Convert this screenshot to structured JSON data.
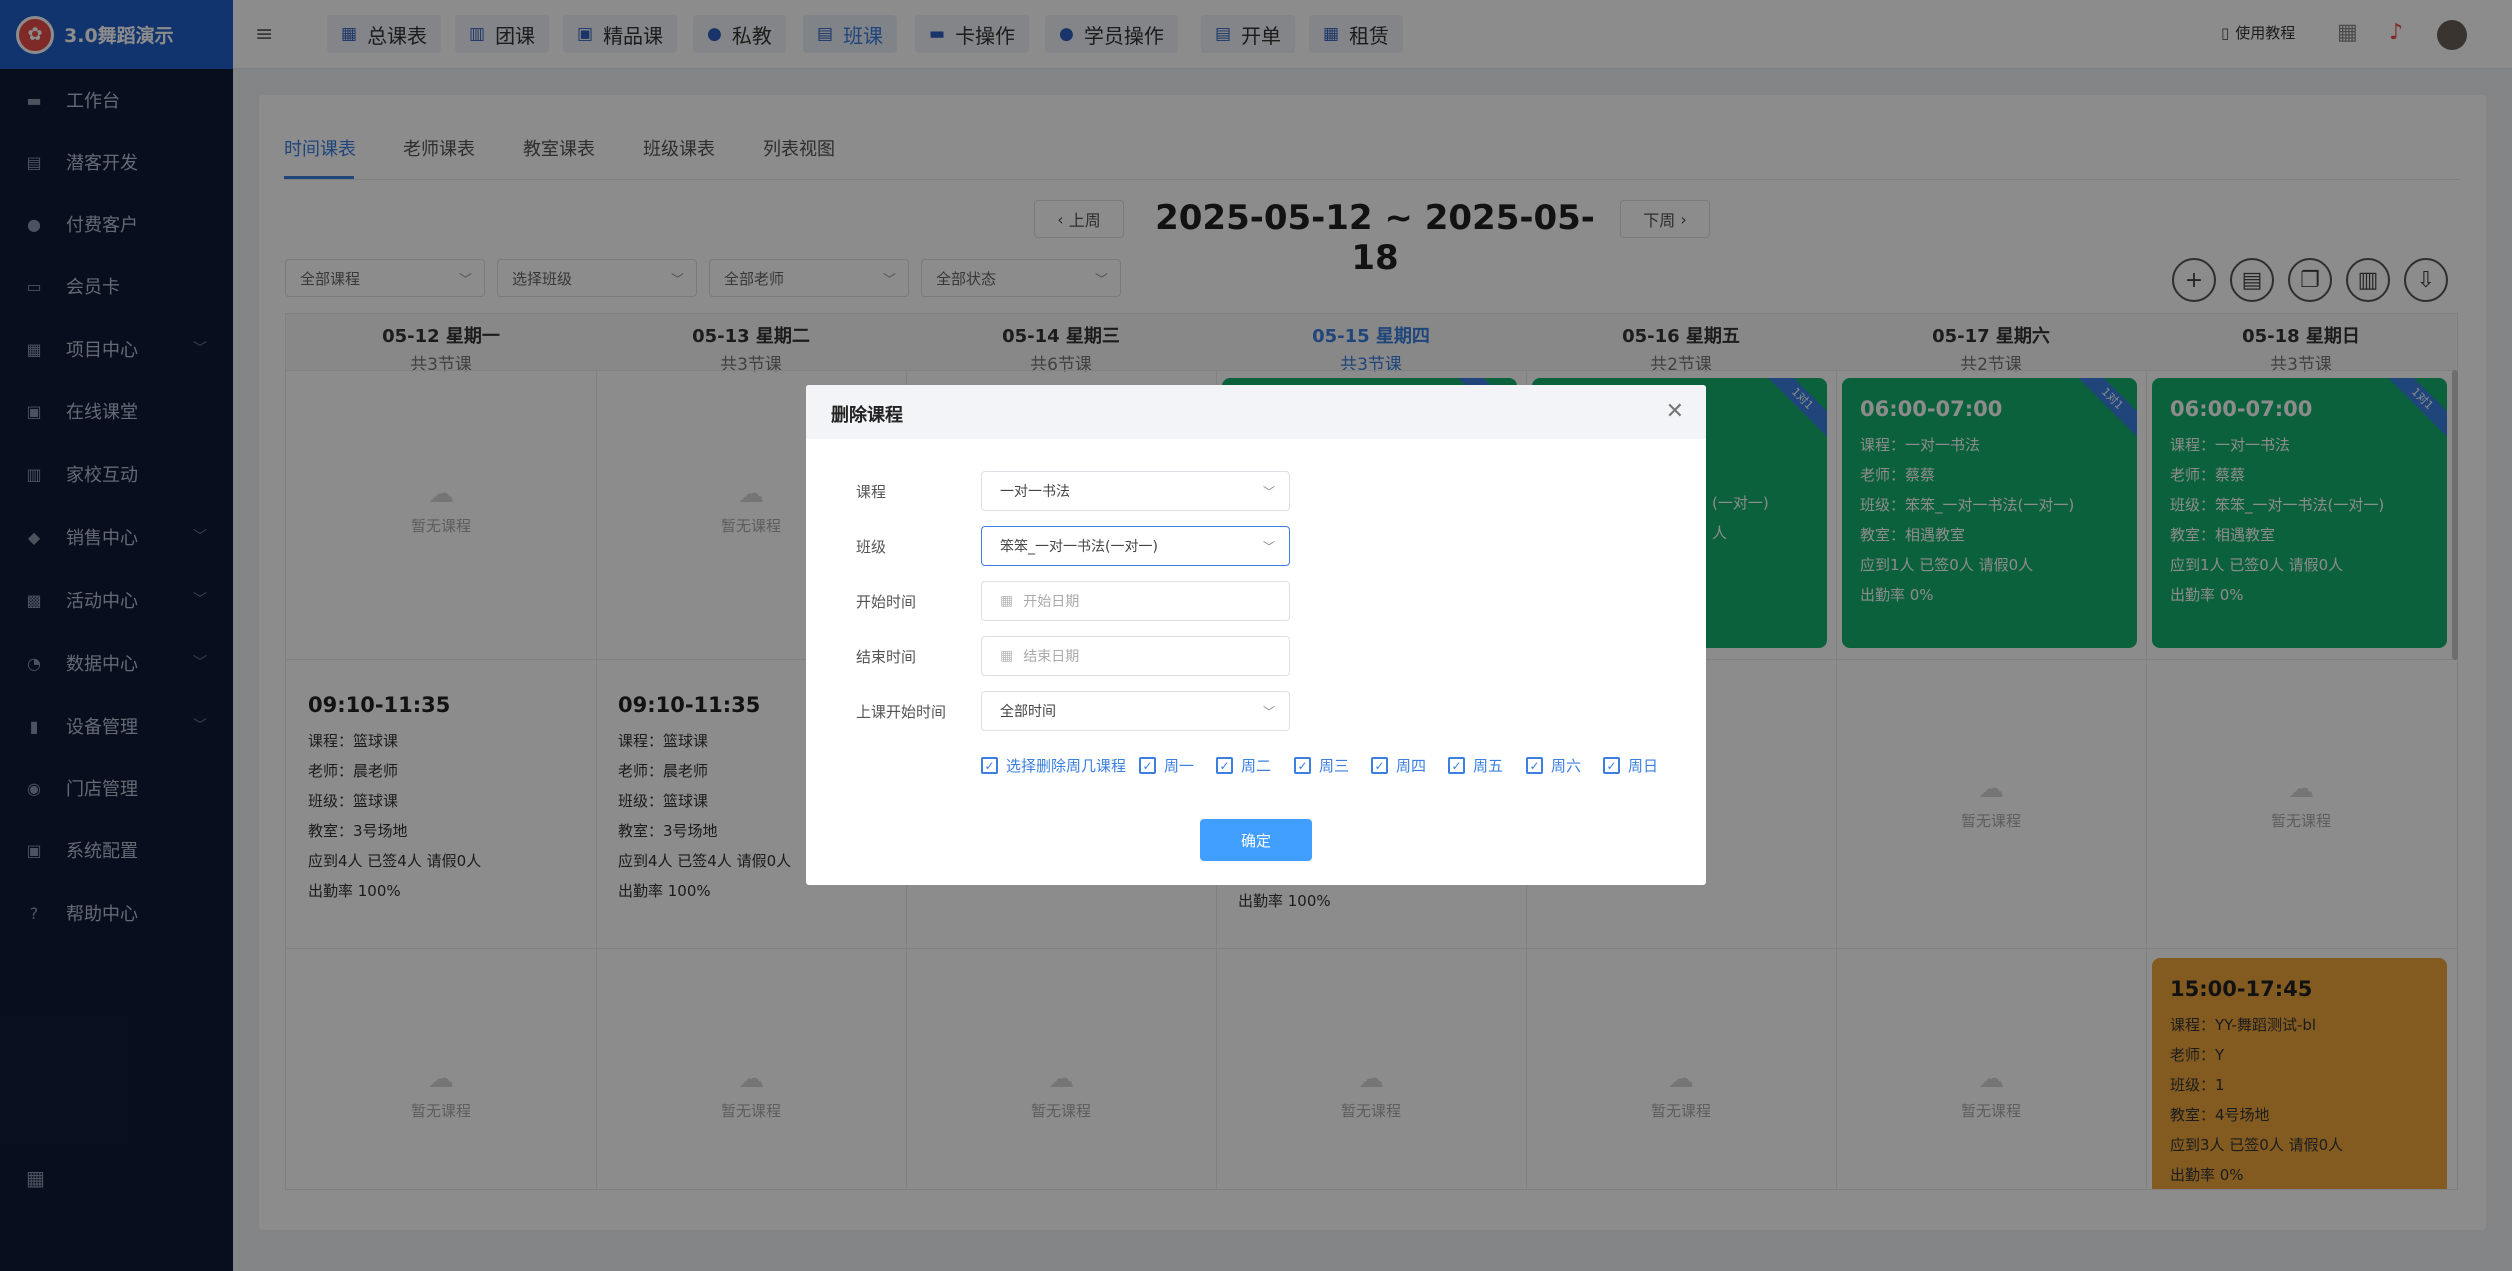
{
  "app": {
    "name": "3.0舞蹈演示",
    "logo_icon": "dance-logo-icon"
  },
  "sidebar": {
    "items": [
      {
        "label": "工作台",
        "icon": "monitor-icon",
        "expandable": false
      },
      {
        "label": "潜客开发",
        "icon": "id-card-icon",
        "expandable": false
      },
      {
        "label": "付费客户",
        "icon": "users-icon",
        "expandable": false
      },
      {
        "label": "会员卡",
        "icon": "card-icon",
        "expandable": false
      },
      {
        "label": "项目中心",
        "icon": "folder-icon",
        "expandable": true
      },
      {
        "label": "在线课堂",
        "icon": "classroom-icon",
        "expandable": false
      },
      {
        "label": "家校互动",
        "icon": "book-icon",
        "expandable": false
      },
      {
        "label": "销售中心",
        "icon": "tag-icon",
        "expandable": true
      },
      {
        "label": "活动中心",
        "icon": "activity-icon",
        "expandable": true
      },
      {
        "label": "数据中心",
        "icon": "pie-chart-icon",
        "expandable": true
      },
      {
        "label": "设备管理",
        "icon": "device-icon",
        "expandable": true
      },
      {
        "label": "门店管理",
        "icon": "store-icon",
        "expandable": false
      },
      {
        "label": "系统配置",
        "icon": "settings-icon",
        "expandable": false
      },
      {
        "label": "帮助中心",
        "icon": "help-icon",
        "expandable": false
      }
    ]
  },
  "topnav": {
    "items": [
      {
        "label": "总课表",
        "icon": "calendar-icon"
      },
      {
        "label": "团课",
        "icon": "book-open-icon"
      },
      {
        "label": "精品课",
        "icon": "bookmark-icon"
      },
      {
        "label": "私教",
        "icon": "people-icon"
      },
      {
        "label": "班课",
        "icon": "class-icon"
      },
      {
        "label": "卡操作",
        "icon": "card-icon"
      },
      {
        "label": "学员操作",
        "icon": "student-icon"
      },
      {
        "label": "开单",
        "icon": "order-icon"
      },
      {
        "label": "租赁",
        "icon": "lease-icon"
      }
    ],
    "active_index": 4,
    "tutorial": "使用教程"
  },
  "view_tabs": [
    "时间课表",
    "老师课表",
    "教室课表",
    "班级课表",
    "列表视图"
  ],
  "week": {
    "prev": "上周",
    "next": "下周",
    "range": "2025-05-12 ~ 2025-05-18"
  },
  "filters": [
    "全部课程",
    "选择班级",
    "全部老师",
    "全部状态"
  ],
  "days": [
    {
      "date": "05-12 星期一",
      "count": "共3节课"
    },
    {
      "date": "05-13 星期二",
      "count": "共3节课"
    },
    {
      "date": "05-14 星期三",
      "count": "共6节课"
    },
    {
      "date": "05-15 星期四",
      "count": "共3节课"
    },
    {
      "date": "05-16 星期五",
      "count": "共2节课"
    },
    {
      "date": "05-17 星期六",
      "count": "共2节课"
    },
    {
      "date": "05-18 星期日",
      "count": "共3节课"
    }
  ],
  "empty_text": "暂无课程",
  "lessons": {
    "row2_mon": {
      "time": "09:10-11:35",
      "lines": [
        "课程：篮球课",
        "老师：晨老师",
        "班级：篮球课",
        "教室：3号场地",
        "应到4人 已签4人 请假0人",
        "出勤率 100%"
      ]
    },
    "row2_tue": {
      "time": "09:10-11:35",
      "lines": [
        "课程：篮球课",
        "老师：晨老师",
        "班级：篮球课",
        "教室：3号场地",
        "应到4人 已签4人 请假0人",
        "出勤率 100%"
      ]
    },
    "row2_thu_tail": "出勤率 100%",
    "row1_fri_partial": [
      "(一对一)",
      "人"
    ],
    "row1_sat": {
      "time": "06:00-07:00",
      "lines": [
        "课程：一对一书法",
        "老师：蔡蔡",
        "班级：笨笨_一对一书法(一对一)",
        "教室：相遇教室",
        "应到1人 已签0人 请假0人",
        "出勤率 0%"
      ],
      "ribbon": "1对1"
    },
    "row1_sun": {
      "time": "06:00-07:00",
      "lines": [
        "课程：一对一书法",
        "老师：蔡蔡",
        "班级：笨笨_一对一书法(一对一)",
        "教室：相遇教室",
        "应到1人 已签0人 请假0人",
        "出勤率 0%"
      ],
      "ribbon": "1对1"
    },
    "row3_sun": {
      "time": "15:00-17:45",
      "lines": [
        "课程：YY-舞蹈测试-bl",
        "老师：Y",
        "班级：1",
        "教室：4号场地",
        "应到3人 已签0人 请假0人",
        "出勤率 0%"
      ]
    },
    "ribbon_text": "1对1"
  },
  "modal": {
    "title": "删除课程",
    "fields": {
      "course_label": "课程",
      "course_value": "一对一书法",
      "class_label": "班级",
      "class_value": "笨笨_一对一书法(一对一)",
      "start_label": "开始时间",
      "start_placeholder": "开始日期",
      "end_label": "结束时间",
      "end_placeholder": "结束日期",
      "class_start_label": "上课开始时间",
      "class_start_value": "全部时间"
    },
    "checkboxes": [
      "选择删除周几课程",
      "周一",
      "周二",
      "周三",
      "周四",
      "周五",
      "周六",
      "周日"
    ],
    "confirm": "确定"
  },
  "colors": {
    "sidebar": "#0e1d3a",
    "logo_bg": "#1f5ec8",
    "accent": "#3b7fe0",
    "green_card": "#14b16c",
    "orange_card": "#efa73d",
    "confirm": "#409eff"
  }
}
